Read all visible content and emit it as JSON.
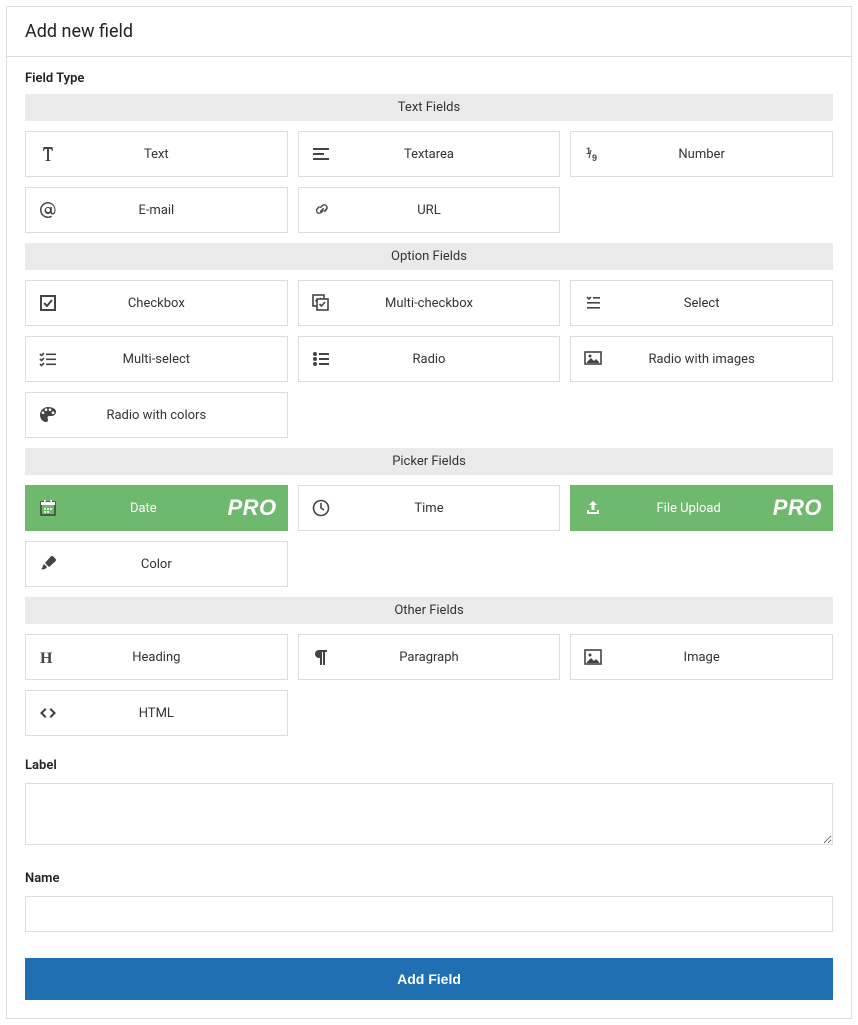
{
  "header": {
    "title": "Add new field"
  },
  "fieldTypeLabel": "Field Type",
  "groups": [
    {
      "title": "Text Fields",
      "items": [
        {
          "label": "Text",
          "icon": "font",
          "pro": false
        },
        {
          "label": "Textarea",
          "icon": "align-left",
          "pro": false
        },
        {
          "label": "Number",
          "icon": "one-nine",
          "pro": false
        },
        {
          "label": "E-mail",
          "icon": "at",
          "pro": false
        },
        {
          "label": "URL",
          "icon": "link",
          "pro": false
        }
      ]
    },
    {
      "title": "Option Fields",
      "items": [
        {
          "label": "Checkbox",
          "icon": "checkbox",
          "pro": false
        },
        {
          "label": "Multi-checkbox",
          "icon": "multi-checkbox",
          "pro": false
        },
        {
          "label": "Select",
          "icon": "select",
          "pro": false
        },
        {
          "label": "Multi-select",
          "icon": "multi-select",
          "pro": false
        },
        {
          "label": "Radio",
          "icon": "radio-list",
          "pro": false
        },
        {
          "label": "Radio with images",
          "icon": "image-radio",
          "pro": false
        },
        {
          "label": "Radio with colors",
          "icon": "palette",
          "pro": false
        }
      ]
    },
    {
      "title": "Picker Fields",
      "items": [
        {
          "label": "Date",
          "icon": "calendar",
          "pro": true
        },
        {
          "label": "Time",
          "icon": "clock",
          "pro": false
        },
        {
          "label": "File Upload",
          "icon": "upload",
          "pro": true
        },
        {
          "label": "Color",
          "icon": "brush",
          "pro": false
        }
      ]
    },
    {
      "title": "Other Fields",
      "items": [
        {
          "label": "Heading",
          "icon": "heading",
          "pro": false
        },
        {
          "label": "Paragraph",
          "icon": "paragraph",
          "pro": false
        },
        {
          "label": "Image",
          "icon": "image",
          "pro": false
        },
        {
          "label": "HTML",
          "icon": "code",
          "pro": false
        }
      ]
    }
  ],
  "proBadge": "PRO",
  "labelField": {
    "label": "Label",
    "value": ""
  },
  "nameField": {
    "label": "Name",
    "value": ""
  },
  "submitLabel": "Add Field"
}
